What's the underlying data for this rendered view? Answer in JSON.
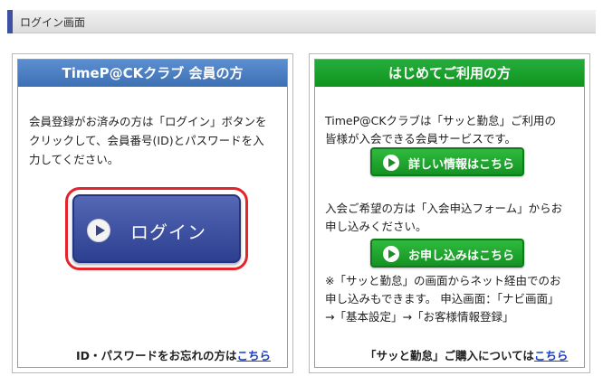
{
  "header": {
    "title": "ログイン画面"
  },
  "left_panel": {
    "heading": "TimeP@CKクラブ 会員の方",
    "description": [
      "会員登録がお済みの方は「ログイン」ボタンを",
      "クリックして、会員番号(ID)とパスワードを入",
      "力してください。"
    ],
    "login_button_label": "ログイン",
    "forgot_text": "ID・パスワードをお忘れの方は",
    "forgot_link": "こちら"
  },
  "right_panel": {
    "heading": "はじめてご利用の方",
    "intro": [
      "TimeP@CKクラブは「サッと勤怠」ご利用の",
      "皆様が入会できる会員サービスです。"
    ],
    "details_button_label": "詳しい情報はこちら",
    "apply_text": [
      "入会ご希望の方は「入会申込フォーム」からお",
      "申し込みください。"
    ],
    "apply_button_label": "お申し込みはこちら",
    "note": [
      "※「サッと勤怠」の画面からネット経由でのお",
      "申し込みもできます。 申込画面：「ナビ画面」",
      "→「基本設定」→「お客様情報登録」"
    ],
    "purchase_text": "「サッと勤怠」ご購入については",
    "purchase_link": "こちら"
  }
}
